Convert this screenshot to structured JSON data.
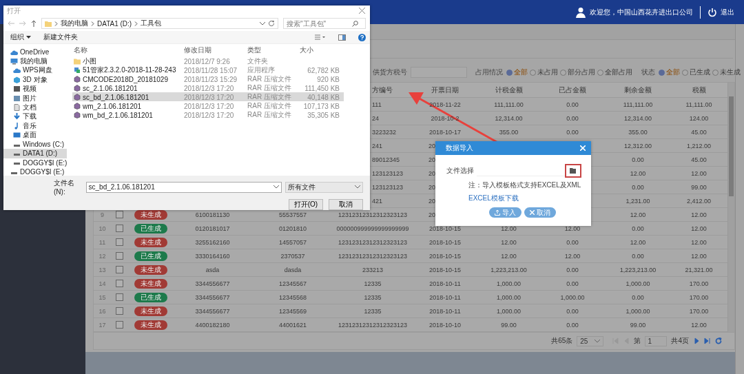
{
  "top_bar": {
    "welcome": "欢迎您，中国山西花卉进出口公司",
    "logout": "退出"
  },
  "filters": {
    "tax_label": "供货方税号",
    "usage": {
      "label": "占用情况",
      "options": [
        {
          "label": "全部",
          "selected": true
        },
        {
          "label": "未占用",
          "selected": false
        },
        {
          "label": "部分占用",
          "selected": false
        },
        {
          "label": "全部占用",
          "selected": false
        }
      ]
    },
    "status": {
      "label": "状态",
      "options": [
        {
          "label": "全部",
          "selected": true
        },
        {
          "label": "已生成",
          "selected": false
        },
        {
          "label": "未生成",
          "selected": false
        }
      ]
    }
  },
  "table": {
    "columns": [
      "方编号",
      "开票日期",
      "计税金额",
      "已占金额",
      "剩余金额",
      "税额"
    ],
    "rows": [
      {
        "cells": [
          "111",
          "2018-11-22",
          "111,111.00",
          "0.00",
          "111,111.00",
          "11,111.00"
        ]
      },
      {
        "cells": [
          "24",
          "2018-10-2",
          "12,314.00",
          "0.00",
          "12,314.00",
          "124.00"
        ]
      },
      {
        "cells": [
          "3223232",
          "2018-10-17",
          "355.00",
          "0.00",
          "355.00",
          "45.00"
        ]
      },
      {
        "cells": [
          "241",
          "20",
          null,
          null,
          "12,312.00",
          "1,212.00"
        ]
      },
      {
        "cells": [
          "89012345",
          "20",
          null,
          null,
          "0.00",
          "45.00"
        ]
      },
      {
        "cells": [
          "123123123",
          "20",
          null,
          null,
          "12.00",
          "12.00"
        ]
      },
      {
        "cells": [
          "123123123",
          "20",
          null,
          null,
          "0.00",
          "99.00"
        ]
      },
      {
        "cells": [
          "421",
          "20",
          null,
          null,
          "1,231.00",
          "2,412.00"
        ]
      },
      {
        "index": "9",
        "checked": false,
        "status": {
          "label": "未生成",
          "generated": false
        },
        "cells": [
          "6100181130",
          "55537557",
          "12312312312312323123",
          "20",
          null,
          null,
          "12.00",
          "12.00"
        ]
      },
      {
        "index": "10",
        "checked": false,
        "status": {
          "label": "已生成",
          "generated": true
        },
        "cells": [
          "0120181017",
          "01201810",
          "000000999999999999999",
          "2018-10-15",
          "12.00",
          "12.00",
          "0.00",
          "12.00"
        ]
      },
      {
        "index": "11",
        "checked": false,
        "status": {
          "label": "未生成",
          "generated": false
        },
        "cells": [
          "3255162160",
          "14557057",
          "12312312312312323123",
          "2018-10-15",
          "12.00",
          "0.00",
          "12.00",
          "12.00"
        ]
      },
      {
        "index": "12",
        "checked": false,
        "status": {
          "label": "已生成",
          "generated": true
        },
        "cells": [
          "3330164160",
          "2370537",
          "12312312312312323123",
          "2018-10-15",
          "12.00",
          "12.00",
          "0.00",
          "12.00"
        ]
      },
      {
        "index": "13",
        "checked": false,
        "status": {
          "label": "未生成",
          "generated": false
        },
        "cells": [
          "asda",
          "dasda",
          "233213",
          "2018-10-15",
          "1,223,213.00",
          "0.00",
          "1,223,213.00",
          "21,321.00"
        ]
      },
      {
        "index": "14",
        "checked": false,
        "status": {
          "label": "未生成",
          "generated": false
        },
        "cells": [
          "3344556677",
          "12345567",
          "12335",
          "2018-10-11",
          "1,000.00",
          "0.00",
          "1,000.00",
          "170.00"
        ]
      },
      {
        "index": "15",
        "checked": false,
        "status": {
          "label": "已生成",
          "generated": true
        },
        "cells": [
          "3344556677",
          "12345568",
          "12335",
          "2018-10-11",
          "1,000.00",
          "1,000.00",
          "0.00",
          "170.00"
        ]
      },
      {
        "index": "16",
        "checked": false,
        "status": {
          "label": "未生成",
          "generated": false
        },
        "cells": [
          "3344556677",
          "12345569",
          "12335",
          "2018-10-11",
          "1,000.00",
          "0.00",
          "1,000.00",
          "170.00"
        ]
      },
      {
        "index": "17",
        "checked": false,
        "status": {
          "label": "未生成",
          "generated": false
        },
        "cells": [
          "4400182180",
          "44001621",
          "12312312312312323123",
          "2018-10-10",
          "99.00",
          "0.00",
          "99.00",
          "12.00"
        ]
      }
    ]
  },
  "pagination": {
    "total": "共65条",
    "page_size": "25",
    "page_label": "第",
    "page": "1",
    "pages": "共4页",
    "nav": [
      {
        "kind": "first",
        "disabled": true
      },
      {
        "kind": "prev",
        "disabled": true
      },
      {
        "kind": "next",
        "disabled": false
      },
      {
        "kind": "last",
        "disabled": false
      },
      {
        "kind": "refresh",
        "disabled": false
      }
    ]
  },
  "file_dialog": {
    "title": "打开",
    "path": [
      "我的电脑",
      "DATA1 (D:)",
      "工具包"
    ],
    "search_placeholder": "搜索\"工具包\"",
    "organize": "组织",
    "new_folder": "新建文件夹",
    "sidebar": [
      {
        "kind": "cloud",
        "label": "OneDrive",
        "selected": false
      },
      {
        "kind": "pc",
        "label": "我的电脑",
        "selected": false,
        "children": [
          {
            "kind": "cloud",
            "label": "WPS网盘",
            "selected": false
          },
          {
            "kind": "cube",
            "label": "3D 对象",
            "selected": false
          },
          {
            "kind": "video",
            "label": "视频",
            "selected": false
          },
          {
            "kind": "image",
            "label": "图片",
            "selected": false
          },
          {
            "kind": "doc",
            "label": "文档",
            "selected": false
          },
          {
            "kind": "download",
            "label": "下载",
            "selected": false
          },
          {
            "kind": "music",
            "label": "音乐",
            "selected": false
          },
          {
            "kind": "desktop",
            "label": "桌面",
            "selected": false
          },
          {
            "kind": "drive",
            "label": "Windows (C:)",
            "selected": false
          },
          {
            "kind": "drive",
            "label": "DATA1 (D:)",
            "selected": true
          },
          {
            "kind": "drive",
            "label": "DOGGY$I (E:)",
            "selected": false
          }
        ]
      },
      {
        "kind": "drive",
        "label": "DOGGY$I (E:)",
        "selected": false
      }
    ],
    "columns": [
      "名称",
      "修改日期",
      "类型",
      "大小"
    ],
    "files": [
      {
        "kind": "folder",
        "name": "小图",
        "date": "2018/12/7 9:26",
        "type": "文件夹",
        "selected": false
      },
      {
        "kind": "app",
        "name": "51管家2.3.2.0-2018-11-28-243",
        "date": "2018/11/28 15:07",
        "type": "应用程序",
        "size": "62,782 KB",
        "selected": false
      },
      {
        "kind": "rar",
        "name": "CMCODE2018D_20181029",
        "date": "2018/11/23 15:29",
        "type": "RAR 压缩文件",
        "size": "920 KB",
        "selected": false
      },
      {
        "kind": "rar",
        "name": "sc_2.1.06.181201",
        "date": "2018/12/3 17:20",
        "type": "RAR 压缩文件",
        "size": "111,450 KB",
        "selected": false
      },
      {
        "kind": "rar",
        "name": "sc_bd_2.1.06.181201",
        "date": "2018/12/3 17:20",
        "type": "RAR 压缩文件",
        "size": "40,148 KB",
        "selected": true
      },
      {
        "kind": "rar",
        "name": "wm_2.1.06.181201",
        "date": "2018/12/3 17:20",
        "type": "RAR 压缩文件",
        "size": "107,173 KB",
        "selected": false
      },
      {
        "kind": "rar",
        "name": "wm_bd_2.1.06.181201",
        "date": "2018/12/3 17:20",
        "type": "RAR 压缩文件",
        "size": "35,305 KB",
        "selected": false
      }
    ],
    "filename_label": "文件名(N):",
    "filename": "sc_bd_2.1.06.181201",
    "filter": "所有文件",
    "open": "打开(O)",
    "cancel": "取消"
  },
  "import_dialog": {
    "title": "数据导入",
    "file_label": "文件选择",
    "note": "注：导入模板格式支持EXCEL及XML",
    "template_link": "EXCEL模板下载",
    "buttons": [
      {
        "kind": "import",
        "label": "导入"
      },
      {
        "kind": "cancel",
        "label": "取消"
      }
    ]
  }
}
